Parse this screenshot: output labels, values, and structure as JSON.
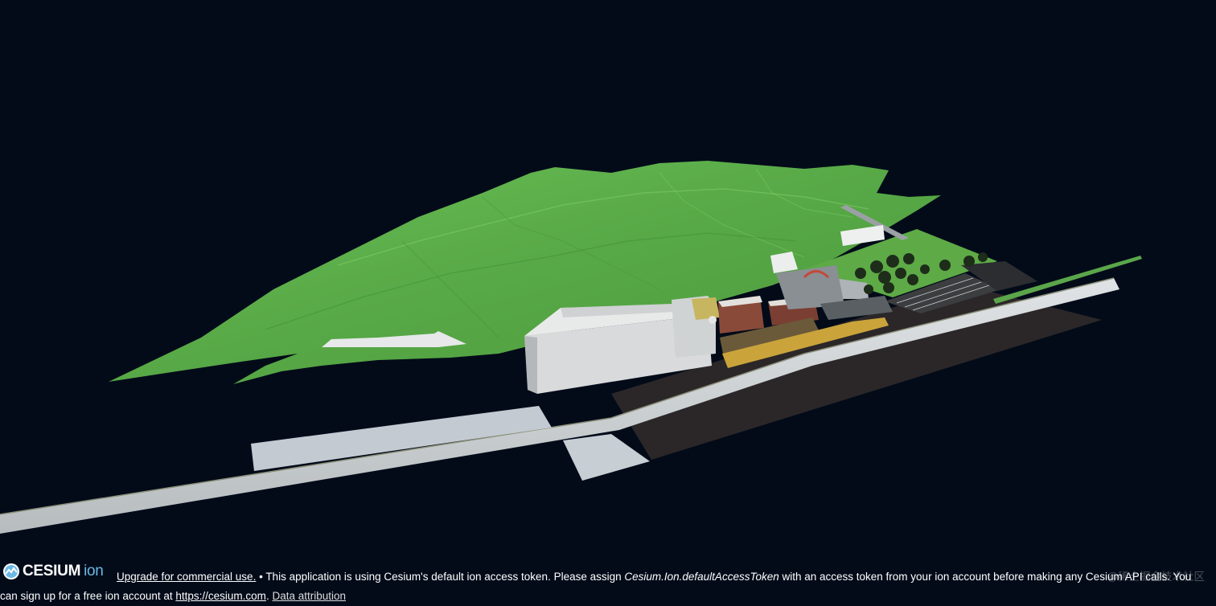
{
  "credits": {
    "logo_word": "CESIUM",
    "logo_suffix": "ion",
    "upgrade_link": "Upgrade for commercial use.",
    "bullet": " • ",
    "token_text_1": "This application is using Cesium's default ion access token. Please assign ",
    "token_var": "Cesium.Ion.defaultAccessToken",
    "token_text_2": " with an access token from your ion account before making any Cesium API calls. You",
    "signup_text": "can sign up for a free ion account at ",
    "cesium_link": "https://cesium.com",
    "period": ". ",
    "data_attribution": "Data attribution"
  },
  "watermark": "@稀土掘金技术社区",
  "colors": {
    "background": "#030b19",
    "terrain": "#5fb04a",
    "road": "#cfd4d6",
    "asphalt": "#2a2627"
  }
}
